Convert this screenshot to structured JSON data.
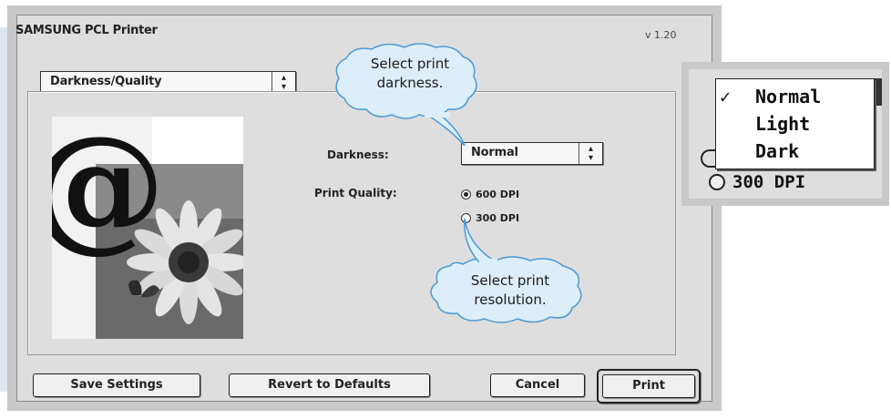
{
  "dialog": {
    "title": "SAMSUNG PCL Printer",
    "version": "v 1.20",
    "panel_select": {
      "value": "Darkness/Quality",
      "icon": "updown-arrows-icon"
    }
  },
  "settings": {
    "darkness": {
      "label": "Darkness:",
      "value": "Normal",
      "icon": "updown-arrows-icon"
    },
    "print_quality": {
      "label": "Print Quality:",
      "options": [
        {
          "label": "600 DPI",
          "selected": true
        },
        {
          "label": "300 DPI",
          "selected": false
        }
      ]
    }
  },
  "buttons": {
    "save_settings": "Save Settings",
    "revert_defaults": "Revert to Defaults",
    "cancel": "Cancel",
    "print": "Print"
  },
  "callouts": {
    "darkness": "Select print darkness.",
    "darkness_lines": [
      "Select print",
      "darkness."
    ],
    "resolution": "Select print resolution.",
    "resolution_lines": [
      "Select print",
      "resolution."
    ]
  },
  "zoom_menu": {
    "items": [
      {
        "label": "Normal",
        "checked": true
      },
      {
        "label": "Light",
        "checked": false
      },
      {
        "label": "Dark",
        "checked": false
      }
    ],
    "check_glyph": "✓",
    "radio_label": "300 DPI"
  },
  "preview": {
    "glyph": "@",
    "icons": [
      "at-sign-icon",
      "sunflower-butterfly-image"
    ]
  },
  "colors": {
    "dialog_bg": "#dedede",
    "frame": "#c9c9c9",
    "callout_fill": "#dceef9",
    "callout_stroke": "#4a9ad4",
    "zoom_beam": "#b9d6ea"
  }
}
